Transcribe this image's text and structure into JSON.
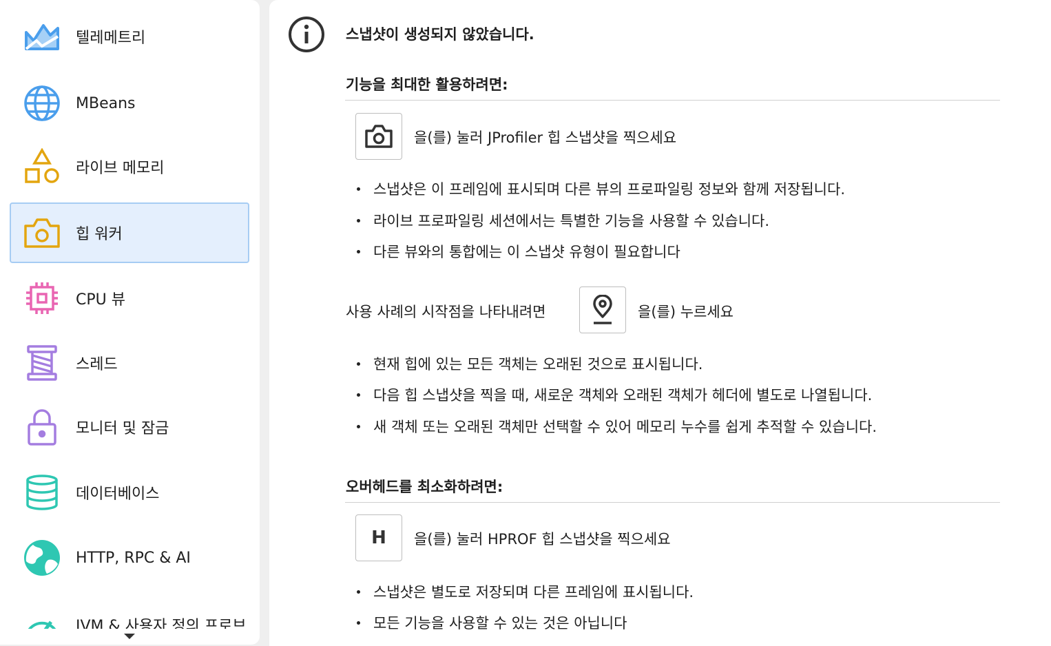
{
  "sidebar": {
    "items": [
      {
        "label": "텔레메트리",
        "icon": "telemetry-icon",
        "color": "#4a9eec"
      },
      {
        "label": "MBeans",
        "icon": "globe-icon",
        "color": "#4a9eec"
      },
      {
        "label": "라이브 메모리",
        "icon": "shapes-icon",
        "color": "#e3a50f"
      },
      {
        "label": "힙 워커",
        "icon": "camera-icon",
        "color": "#e3a50f",
        "selected": true
      },
      {
        "label": "CPU 뷰",
        "icon": "cpu-chip-icon",
        "color": "#e965b2"
      },
      {
        "label": "스레드",
        "icon": "spool-icon",
        "color": "#a47de0"
      },
      {
        "label": "모니터 및 잠금",
        "icon": "lock-icon",
        "color": "#a47de0"
      },
      {
        "label": "데이터베이스",
        "icon": "database-icon",
        "color": "#2ec7b2"
      },
      {
        "label": "HTTP, RPC & AI",
        "icon": "network-globe-icon",
        "color": "#2ec7b2"
      },
      {
        "label": "JVM & 사용자 정의 프로브",
        "icon": "gauge-icon",
        "color": "#2ec7b2"
      }
    ]
  },
  "main": {
    "title": "스냅샷이 생성되지 않았습니다.",
    "section1": {
      "heading": "기능을 최대한 활용하려면:",
      "action_text": "을(를) 눌러 JProfiler 힙 스냅샷을 찍으세요",
      "bullets": [
        "스냅샷은 이 프레임에 표시되며 다른 뷰의 프로파일링 정보와 함께 저장됩니다.",
        "라이브 프로파일링 세션에서는 특별한 기능을 사용할 수 있습니다.",
        "다른 뷰와의 통합에는 이 스냅샷 유형이 필요합니다"
      ],
      "mark_prefix": "사용 사례의 시작점을 나타내려면",
      "mark_suffix": "을(를) 누르세요",
      "mark_bullets": [
        "현재 힙에 있는 모든 객체는 오래된 것으로 표시됩니다.",
        "다음 힙 스냅샷을 찍을 때, 새로운 객체와 오래된 객체가 헤더에 별도로 나열됩니다.",
        "새 객체 또는 오래된 객체만 선택할 수 있어 메모리 누수를 쉽게 추적할 수 있습니다."
      ]
    },
    "section2": {
      "heading": "오버헤드를 최소화하려면:",
      "button_letter": "H",
      "action_text": "을(를) 눌러 HPROF 힙 스냅샷을 찍으세요",
      "bullets": [
        "스냅샷은 별도로 저장되며 다른 프레임에 표시됩니다.",
        "모든 기능을 사용할 수 있는 것은 아닙니다"
      ]
    }
  }
}
